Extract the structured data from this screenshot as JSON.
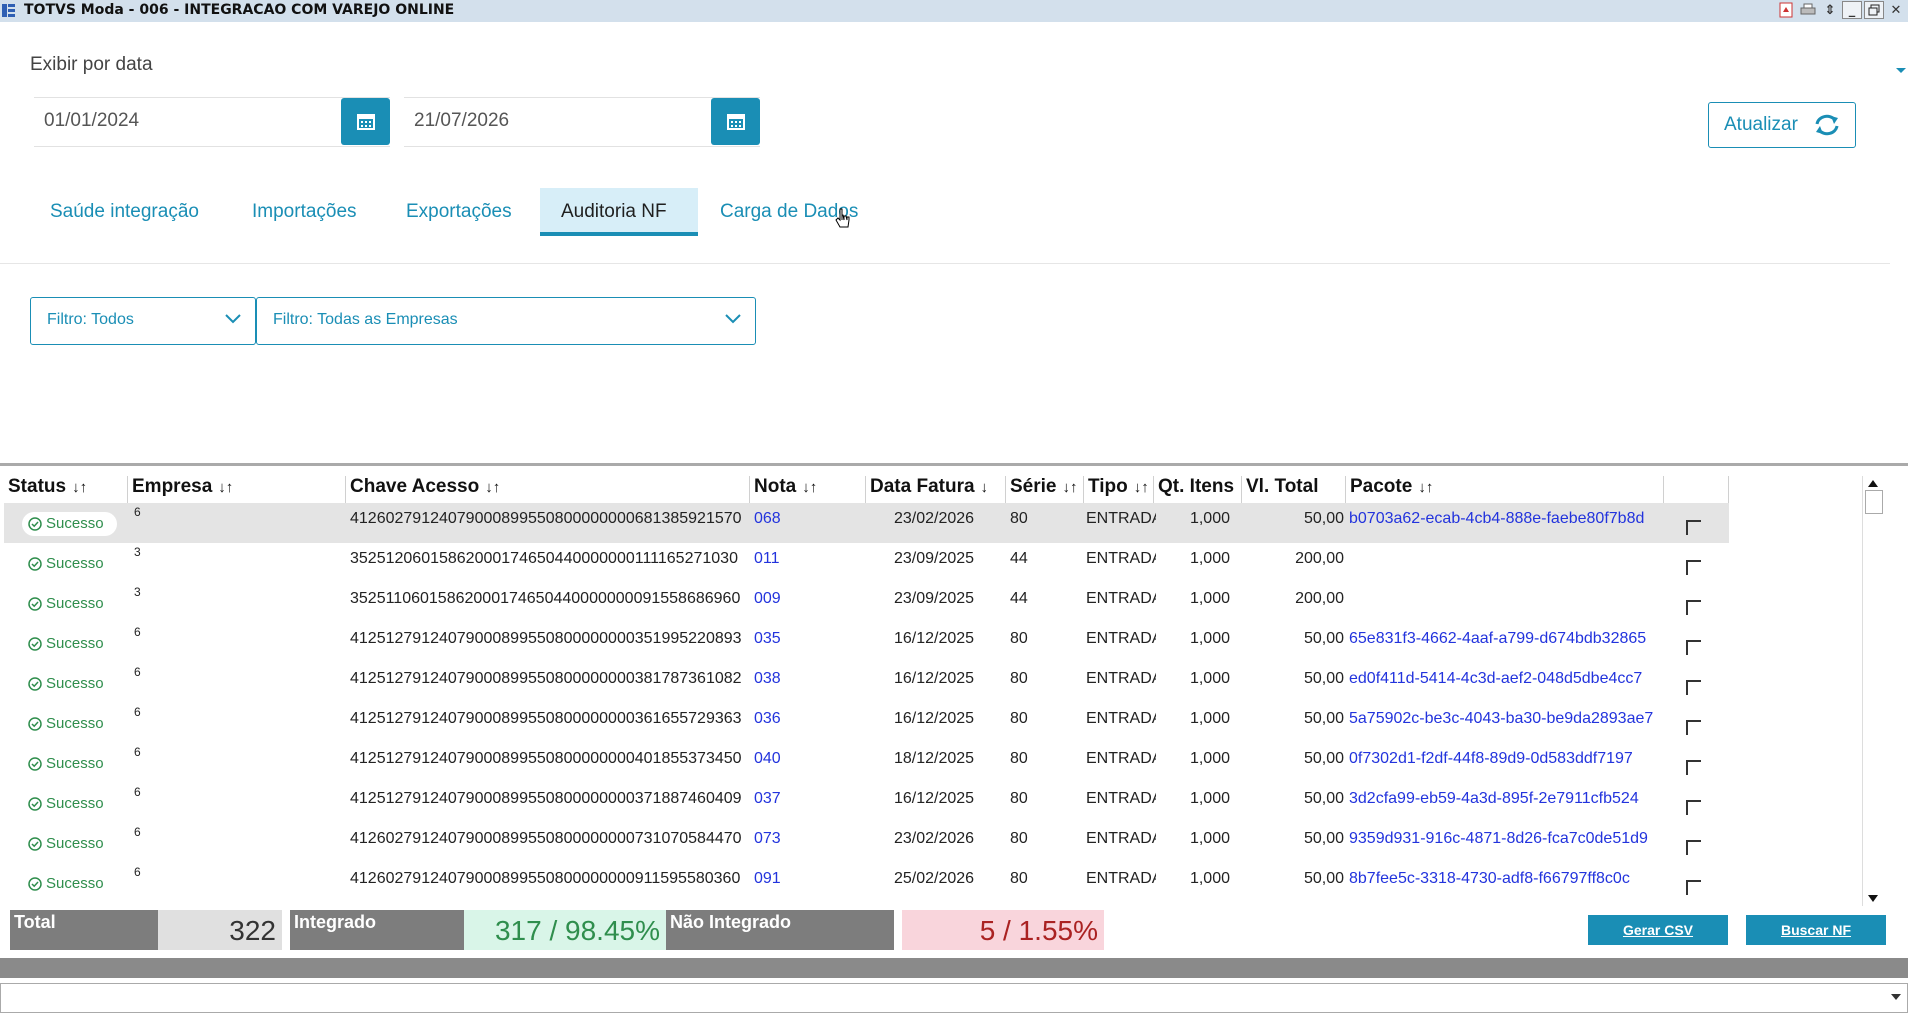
{
  "window": {
    "title": "TOTVS Moda - 006 - INTEGRACAO COM VAREJO ONLINE"
  },
  "filters_top": {
    "exibir_label": "Exibir por data",
    "date_start": "01/01/2024",
    "date_end": "21/07/2026",
    "refresh_label": "Atualizar"
  },
  "tabs": [
    {
      "label": "Saúde integração"
    },
    {
      "label": "Importações"
    },
    {
      "label": "Exportações"
    },
    {
      "label": "Auditoria NF"
    },
    {
      "label": "Carga de Dados"
    }
  ],
  "active_tab": "Auditoria NF",
  "filters": {
    "status": "Filtro: Todos",
    "empresa": "Filtro: Todas as Empresas"
  },
  "table": {
    "columns": [
      {
        "label": "Status",
        "sort": "↓↑"
      },
      {
        "label": "Empresa",
        "sort": "↓↑"
      },
      {
        "label": "Chave Acesso",
        "sort": "↓↑"
      },
      {
        "label": "Nota",
        "sort": "↓↑"
      },
      {
        "label": "Data Fatura",
        "sort": "↓"
      },
      {
        "label": "Série",
        "sort": "↓↑"
      },
      {
        "label": "Tipo",
        "sort": "↓↑"
      },
      {
        "label": "Qt. Itens",
        "sort": ""
      },
      {
        "label": "Vl. Total",
        "sort": ""
      },
      {
        "label": "Pacote",
        "sort": "↓↑"
      }
    ],
    "rows": [
      {
        "status": "Sucesso",
        "empresa": "6",
        "chave": "41260279124079000899550800000000681385921570",
        "nota": "068",
        "data": "23/02/2026",
        "serie": "80",
        "tipo": "ENTRADA",
        "qt": "1,000",
        "vl": "50,00",
        "pacote": "b0703a62-ecab-4cb4-888e-faebe80f7b8d",
        "selected": true
      },
      {
        "status": "Sucesso",
        "empresa": "3",
        "chave": "35251206015862000174650440000000111165271030",
        "nota": "011",
        "data": "23/09/2025",
        "serie": "44",
        "tipo": "ENTRADA",
        "qt": "1,000",
        "vl": "200,00",
        "pacote": ""
      },
      {
        "status": "Sucesso",
        "empresa": "3",
        "chave": "35251106015862000174650440000000091558686960",
        "nota": "009",
        "data": "23/09/2025",
        "serie": "44",
        "tipo": "ENTRADA",
        "qt": "1,000",
        "vl": "200,00",
        "pacote": ""
      },
      {
        "status": "Sucesso",
        "empresa": "6",
        "chave": "41251279124079000899550800000000351995220893",
        "nota": "035",
        "data": "16/12/2025",
        "serie": "80",
        "tipo": "ENTRADA",
        "qt": "1,000",
        "vl": "50,00",
        "pacote": "65e831f3-4662-4aaf-a799-d674bdb32865"
      },
      {
        "status": "Sucesso",
        "empresa": "6",
        "chave": "41251279124079000899550800000000381787361082",
        "nota": "038",
        "data": "16/12/2025",
        "serie": "80",
        "tipo": "ENTRADA",
        "qt": "1,000",
        "vl": "50,00",
        "pacote": "ed0f411d-5414-4c3d-aef2-048d5dbe4cc7"
      },
      {
        "status": "Sucesso",
        "empresa": "6",
        "chave": "41251279124079000899550800000000361655729363",
        "nota": "036",
        "data": "16/12/2025",
        "serie": "80",
        "tipo": "ENTRADA",
        "qt": "1,000",
        "vl": "50,00",
        "pacote": "5a75902c-be3c-4043-ba30-be9da2893ae7"
      },
      {
        "status": "Sucesso",
        "empresa": "6",
        "chave": "41251279124079000899550800000000401855373450",
        "nota": "040",
        "data": "18/12/2025",
        "serie": "80",
        "tipo": "ENTRADA",
        "qt": "1,000",
        "vl": "50,00",
        "pacote": "0f7302d1-f2df-44f8-89d9-0d583ddf7197"
      },
      {
        "status": "Sucesso",
        "empresa": "6",
        "chave": "41251279124079000899550800000000371887460409",
        "nota": "037",
        "data": "16/12/2025",
        "serie": "80",
        "tipo": "ENTRADA",
        "qt": "1,000",
        "vl": "50,00",
        "pacote": "3d2cfa99-eb59-4a3d-895f-2e7911cfb524"
      },
      {
        "status": "Sucesso",
        "empresa": "6",
        "chave": "41260279124079000899550800000000731070584470",
        "nota": "073",
        "data": "23/02/2026",
        "serie": "80",
        "tipo": "ENTRADA",
        "qt": "1,000",
        "vl": "50,00",
        "pacote": "9359d931-916c-4871-8d26-fca7c0de51d9"
      },
      {
        "status": "Sucesso",
        "empresa": "6",
        "chave": "41260279124079000899550800000000911595580360",
        "nota": "091",
        "data": "25/02/2026",
        "serie": "80",
        "tipo": "ENTRADA",
        "qt": "1,000",
        "vl": "50,00",
        "pacote": "8b7fee5c-3318-4730-adf8-f66797ff8c0c"
      }
    ]
  },
  "summary": {
    "total_label": "Total",
    "total_value": "322",
    "integrado_label": "Integrado",
    "integrado_value": "317 / 98.45%",
    "nao_label": "Não Integrado",
    "nao_value": "5 / 1.55%"
  },
  "actions": {
    "csv": "Gerar CSV",
    "buscar": "Buscar NF"
  },
  "colors": {
    "accent": "#1a8eb5",
    "success_text": "#2f8e4d",
    "integrado_bg": "#d9f5e8",
    "nao_integrado_bg": "#f9d5dc",
    "link": "#2233dd"
  }
}
